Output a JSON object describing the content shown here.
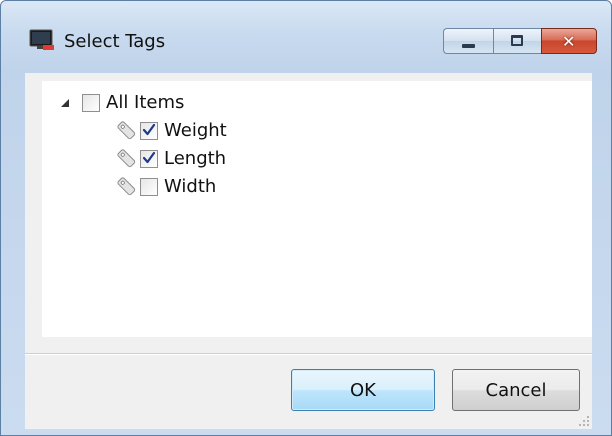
{
  "window": {
    "title": "Select Tags",
    "icon": "app-monitor-icon"
  },
  "tree": {
    "root": {
      "label": "All Items",
      "checked": false,
      "expanded": true
    },
    "items": [
      {
        "label": "Weight",
        "checked": true,
        "icon": "tag-icon"
      },
      {
        "label": "Length",
        "checked": true,
        "icon": "tag-icon"
      },
      {
        "label": "Width",
        "checked": false,
        "icon": "tag-icon"
      }
    ]
  },
  "buttons": {
    "ok_label": "OK",
    "cancel_label": "Cancel"
  },
  "colors": {
    "titlebar": "#c9dbef",
    "close_button": "#c8462d",
    "default_button_border": "#3c7fb1",
    "checkmark": "#1e3a8a"
  }
}
